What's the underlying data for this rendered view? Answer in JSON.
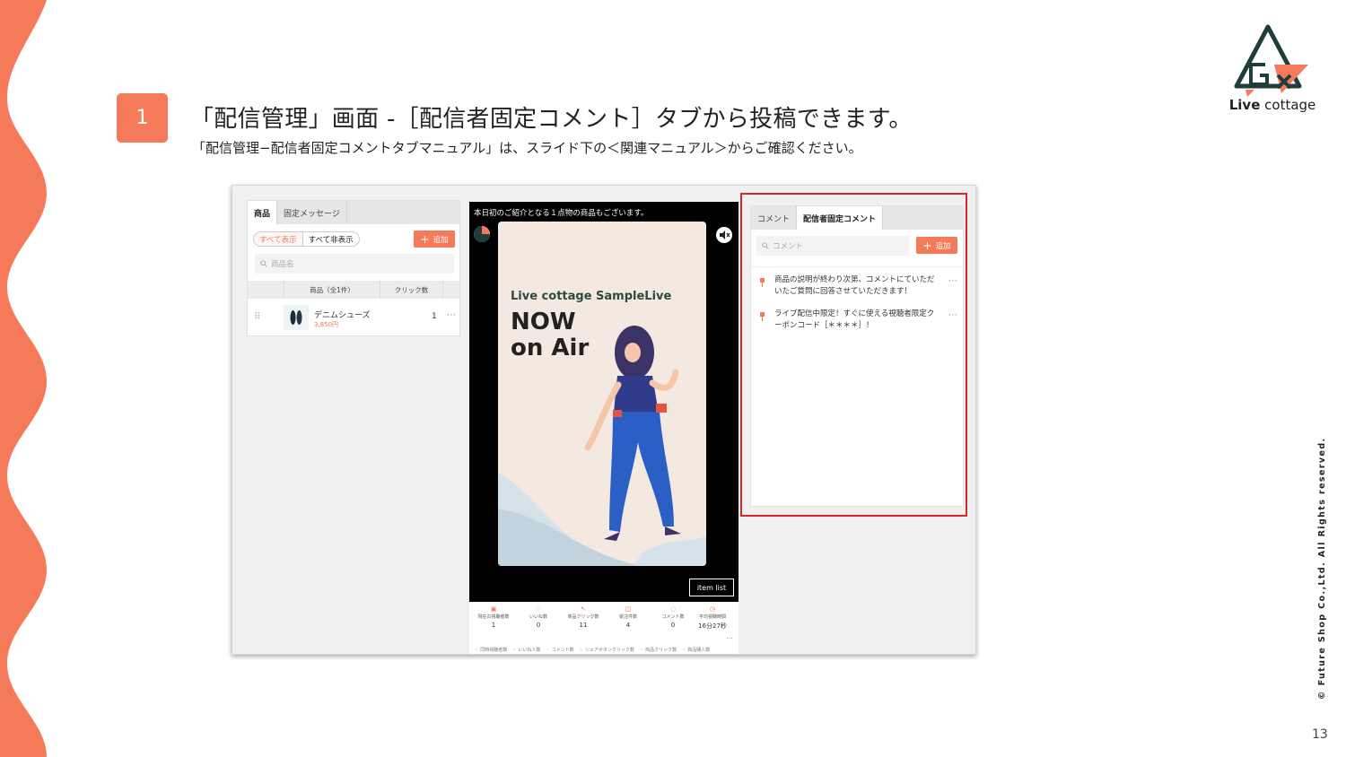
{
  "slide": {
    "step_number": "1",
    "title": "「配信管理」画面 -［配信者固定コメント］タブから投稿できます。",
    "subtitle": "「配信管理−配信者固定コメントタブマニュアル」は、スライド下の＜関連マニュアル＞からご確認ください。",
    "logo_bold": "Live",
    "logo_rest": " cottage",
    "copyright": "© Future Shop Co.,Ltd. All Rights reserved.",
    "page_number": "13",
    "colors": {
      "accent": "#f47a5a",
      "highlight": "#d9262a",
      "logo_green": "#1f3d3a"
    }
  },
  "product_panel": {
    "tabs": [
      "商品",
      "固定メッセージ"
    ],
    "show_all": "すべて表示",
    "hide_all": "すべて非表示",
    "add_label": "追加",
    "search_placeholder": "商品名",
    "table_headers": [
      "商品（全1件）",
      "クリック数"
    ],
    "rows": [
      {
        "name": "デニムシューズ",
        "price": "3,850円",
        "clicks": "1"
      }
    ]
  },
  "player": {
    "title": "本日初のご紹介となる１点物の商品もございます。",
    "poster_subtitle": "Live cottage SampleLive",
    "poster_line1": "NOW",
    "poster_line2": "on Air",
    "item_list_label": "item list",
    "stats": [
      {
        "label": "現在の視聴者数",
        "value": "1"
      },
      {
        "label": "いいね数",
        "value": "0"
      },
      {
        "label": "商品クリック数",
        "value": "11"
      },
      {
        "label": "受注件数",
        "value": "4"
      },
      {
        "label": "コメント数",
        "value": "0"
      },
      {
        "label": "平均視聴時間",
        "value": "16分27秒"
      }
    ],
    "legend": [
      "同時視聴者数",
      "いいね人数",
      "コメント数",
      "シェアボタンクリック数",
      "商品クリック数",
      "商品購入数"
    ]
  },
  "comment_panel": {
    "tabs": [
      "コメント",
      "配信者固定コメント"
    ],
    "search_placeholder": "コメント",
    "add_label": "追加",
    "comments": [
      {
        "text": "商品の説明が終わり次第、コメントにていただいたご質問に回答させていただきます！"
      },
      {
        "text": "ライブ配信中限定！すぐに使える視聴者限定クーポンコード［＊＊＊＊］！"
      }
    ]
  }
}
